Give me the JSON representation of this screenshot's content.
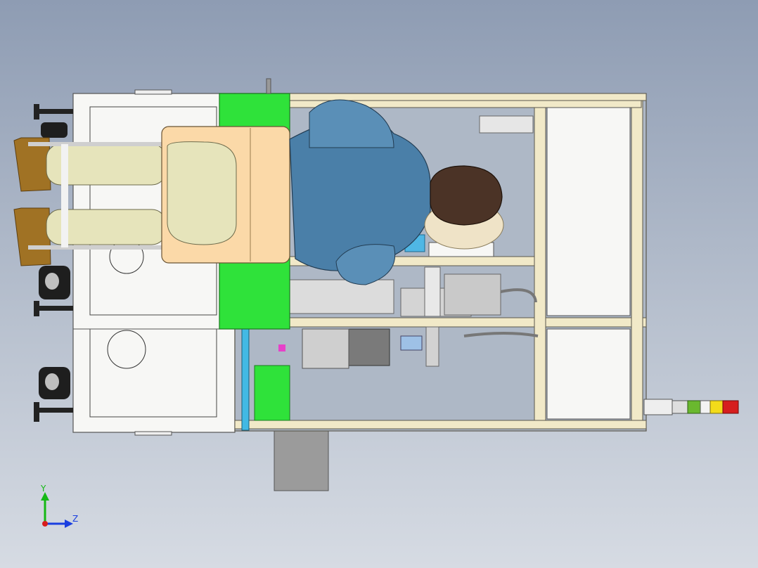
{
  "viewport": {
    "background_top": "#8e9cb3",
    "background_bottom": "#d6dbe3"
  },
  "colors": {
    "frame": "#f1e9c8",
    "frame_edge": "#5b584c",
    "panel_white": "#f7f7f5",
    "green_panel": "#2fe23a",
    "tan_panel": "#fbd9a8",
    "shirt": "#4a7fa8",
    "hair": "#4b3326",
    "skin": "#efe3c7",
    "legs": "#e6e4bb",
    "shoes": "#a07224",
    "stack_red": "#d61e1e",
    "stack_yellow": "#f3dc1a",
    "stack_green": "#6ab82e"
  },
  "triad": {
    "y_label": "Y",
    "z_label": "Z",
    "y_color": "#14b814",
    "z_color": "#1a3fe0",
    "x_color": "#d81d1d"
  },
  "parts": [
    "operator-figure",
    "aluminum-profile-frame",
    "green-side-panel",
    "tan-work-tray",
    "leveling-foot",
    "caster-wheel",
    "signal-tower-light",
    "support-leg"
  ]
}
